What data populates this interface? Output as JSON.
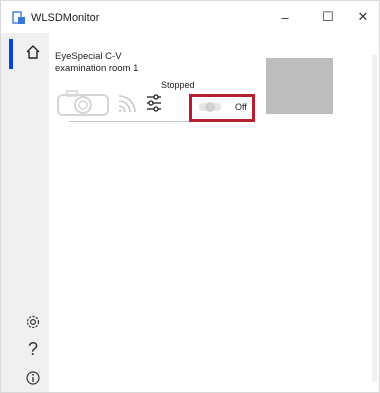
{
  "window": {
    "title": "WLSDMonitor",
    "controls": {
      "minimize": "–",
      "maximize": "☐",
      "close": "✕"
    }
  },
  "sidebar": {
    "items": [
      {
        "name": "home",
        "icon": "home-icon",
        "active": true
      },
      {
        "name": "settings",
        "icon": "gear-icon"
      },
      {
        "name": "help",
        "icon": "question-icon",
        "glyph": "?"
      },
      {
        "name": "about",
        "icon": "info-icon"
      }
    ]
  },
  "device": {
    "name_line1": "EyeSpecial C-V",
    "name_line2": "examination room 1",
    "status": "Stopped",
    "toggle_label": "Off",
    "toggle_state": "off",
    "icons": [
      "camera-icon",
      "wireless-signal-icon",
      "sliders-settings-icon"
    ]
  },
  "colors": {
    "accent": "#0b3fe0",
    "highlight": "#b51f2d",
    "preview": "#bdbdbd"
  }
}
